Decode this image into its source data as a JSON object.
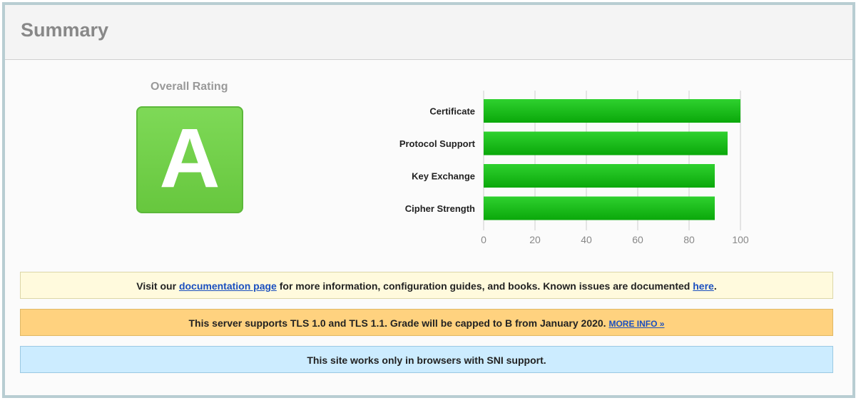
{
  "header": {
    "title": "Summary"
  },
  "rating": {
    "label": "Overall Rating",
    "grade": "A"
  },
  "chart_data": {
    "type": "bar",
    "orientation": "horizontal",
    "categories": [
      "Certificate",
      "Protocol Support",
      "Key Exchange",
      "Cipher Strength"
    ],
    "values": [
      100,
      95,
      90,
      90
    ],
    "xlim": [
      0,
      100
    ],
    "ticks": [
      "0",
      "20",
      "40",
      "60",
      "80",
      "100"
    ],
    "grid": true,
    "bar_color": "#16b916"
  },
  "banners": {
    "doc": {
      "prefix": "Visit our ",
      "link1": "documentation page",
      "middle": " for more information, configuration guides, and books. Known issues are documented ",
      "link2": "here",
      "suffix": "."
    },
    "tls": {
      "text": "This server supports TLS 1.0 and TLS 1.1. Grade will be capped to B from January 2020. ",
      "link": "MORE INFO »"
    },
    "sni": {
      "text": "This site works only in browsers with SNI support."
    }
  },
  "colors": {
    "grade_green": "#7ed957",
    "doc_banner": "#fffadd",
    "tls_banner": "#ffd27f",
    "sni_banner": "#ccecff",
    "frame_border": "#b8cdd2"
  }
}
